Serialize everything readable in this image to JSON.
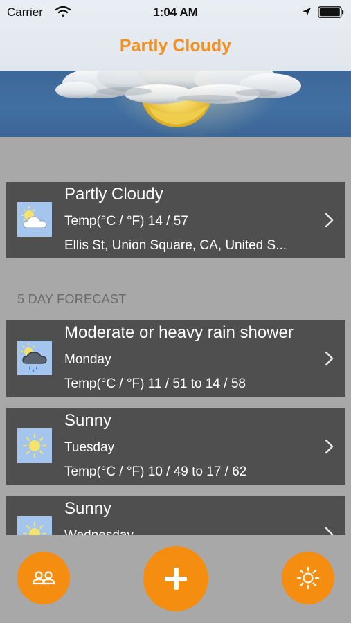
{
  "status_bar": {
    "carrier": "Carrier",
    "time": "1:04 AM"
  },
  "header": {
    "title": "Partly Cloudy",
    "title_color": "#f5901c"
  },
  "current": {
    "condition": "Partly Cloudy",
    "temp": "Temp(°C / °F) 14 / 57",
    "location": "Ellis St, Union Square, CA, United S...",
    "icon": "partly-cloudy-icon"
  },
  "forecast": {
    "section_label": "5 DAY FORECAST",
    "days": [
      {
        "condition": "Moderate or heavy rain shower",
        "day": "Monday",
        "temp": "Temp(°C / °F) 11 / 51 to 14 / 58",
        "icon": "rain-shower-icon"
      },
      {
        "condition": "Sunny",
        "day": "Tuesday",
        "temp": "Temp(°C / °F) 10 / 49 to 17 / 62",
        "icon": "sun-icon"
      },
      {
        "condition": "Sunny",
        "day": "Wednesday",
        "temp": "",
        "icon": "sun-icon"
      }
    ]
  },
  "bottom_bar": {
    "left_button_icon": "people-icon",
    "center_button_icon": "plus-icon",
    "right_button_icon": "sun-icon",
    "accent": "#f58d10"
  }
}
